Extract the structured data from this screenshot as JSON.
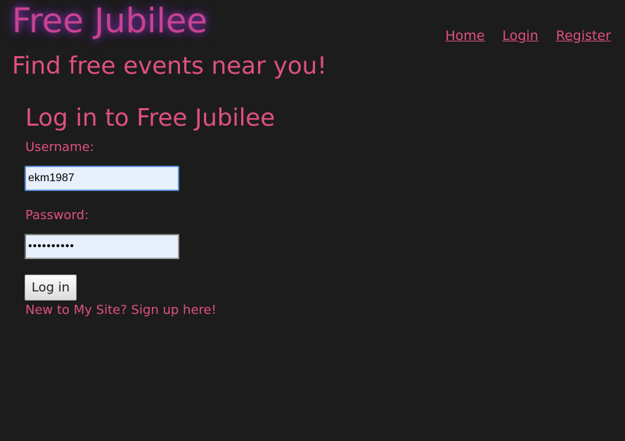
{
  "header": {
    "site_title": "Free Jubilee",
    "tagline": "Find free events near you!",
    "nav": {
      "home": "Home",
      "login": "Login",
      "register": "Register"
    }
  },
  "login_form": {
    "heading": "Log in to Free Jubilee",
    "username_label": "Username:",
    "username_value": "ekm1987",
    "password_label": "Password:",
    "password_value": "••••••••••",
    "submit_label": "Log in",
    "signup_text": "New to My Site? Sign up here!"
  },
  "colors": {
    "background": "#1c1c1c",
    "accent": "#e0517e",
    "title": "#c8438f",
    "title_glow": "#7a2fa0",
    "input_background": "#e8f0fe",
    "input_focus_border": "#5b8fd6"
  }
}
